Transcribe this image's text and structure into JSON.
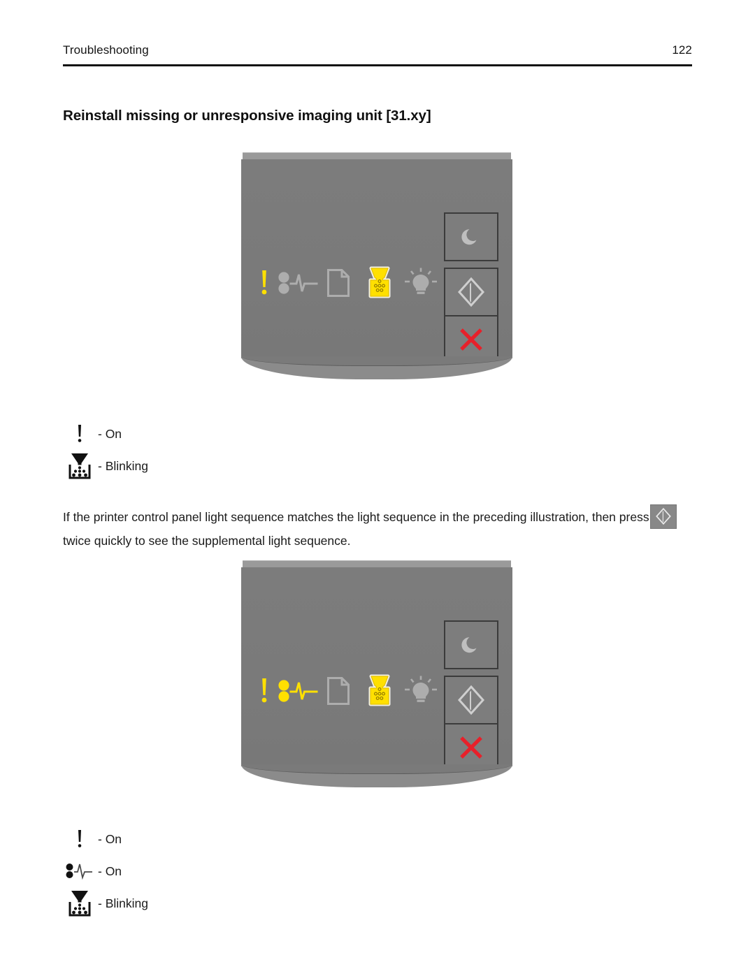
{
  "header": {
    "section": "Troubleshooting",
    "page_number": "122"
  },
  "title": "Reinstall missing or unresponsive imaging unit [31.xy]",
  "panels": [
    {
      "name": "primary-light-sequence",
      "indicators": [
        {
          "icon": "error-exclamation-icon",
          "state": "lit"
        },
        {
          "icon": "paper-jam-icon",
          "state": "unlit"
        },
        {
          "icon": "load-paper-icon",
          "state": "unlit"
        },
        {
          "icon": "toner-imaging-unit-icon",
          "state": "lit"
        },
        {
          "icon": "toner-low-bulb-icon",
          "state": "unlit"
        }
      ],
      "buttons": [
        {
          "icon": "sleep-moon-icon",
          "label": "Sleep"
        },
        {
          "icon": "start-diamond-icon",
          "label": "Start"
        },
        {
          "icon": "cancel-x-icon",
          "label": "Cancel"
        }
      ]
    },
    {
      "name": "supplemental-light-sequence",
      "indicators": [
        {
          "icon": "error-exclamation-icon",
          "state": "lit"
        },
        {
          "icon": "paper-jam-icon",
          "state": "lit"
        },
        {
          "icon": "load-paper-icon",
          "state": "unlit"
        },
        {
          "icon": "toner-imaging-unit-icon",
          "state": "lit"
        },
        {
          "icon": "toner-low-bulb-icon",
          "state": "unlit"
        }
      ],
      "buttons": [
        {
          "icon": "sleep-moon-icon",
          "label": "Sleep"
        },
        {
          "icon": "start-diamond-icon",
          "label": "Start"
        },
        {
          "icon": "cancel-x-icon",
          "label": "Cancel"
        }
      ]
    }
  ],
  "legend_primary": [
    {
      "icon": "error-exclamation-icon",
      "text": "- On"
    },
    {
      "icon": "toner-imaging-unit-icon",
      "text": "- Blinking"
    }
  ],
  "legend_supplemental": [
    {
      "icon": "error-exclamation-icon",
      "text": "- On"
    },
    {
      "icon": "paper-jam-icon",
      "text": "- On"
    },
    {
      "icon": "toner-imaging-unit-icon",
      "text": "- Blinking"
    }
  ],
  "body": {
    "text_before_button": "If the printer control panel light sequence matches the light sequence in the preceding illustration, then press",
    "inline_button_icon": "start-diamond-icon",
    "text_after_button": "twice quickly to see the supplemental light sequence."
  },
  "colors": {
    "lit_yellow": "#FFE000",
    "unlit_gray": "#AFAFAF",
    "panel_face": "#7B7B7B",
    "cancel_red": "#E8202A",
    "text": "#1A1A1A"
  }
}
